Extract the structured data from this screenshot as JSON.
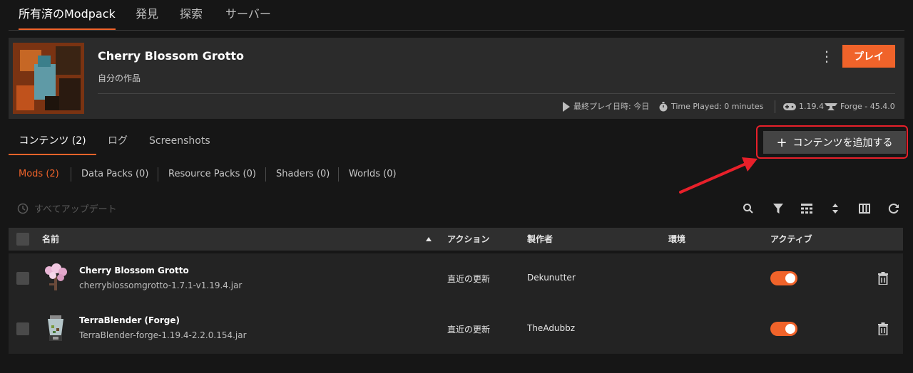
{
  "top_tabs": [
    {
      "label": "所有済のModpack",
      "active": true
    },
    {
      "label": "発見",
      "active": false
    },
    {
      "label": "探索",
      "active": false
    },
    {
      "label": "サーバー",
      "active": false
    }
  ],
  "modpack": {
    "title": "Cherry Blossom Grotto",
    "subtitle": "自分の作品",
    "play_label": "プレイ",
    "last_played": "最終プレイ日時: 今日",
    "time_played": "Time Played: 0 minutes",
    "mc_version": "1.19.4",
    "loader": "Forge - 45.4.0"
  },
  "content_tabs": [
    {
      "label": "コンテンツ (2)",
      "active": true
    },
    {
      "label": "ログ",
      "active": false
    },
    {
      "label": "Screenshots",
      "active": false
    }
  ],
  "add_content_label": "コンテンツを追加する",
  "sub_tabs": [
    {
      "label": "Mods (2)",
      "active": true
    },
    {
      "label": "Data Packs (0)",
      "active": false
    },
    {
      "label": "Resource Packs (0)",
      "active": false
    },
    {
      "label": "Shaders (0)",
      "active": false
    },
    {
      "label": "Worlds (0)",
      "active": false
    }
  ],
  "update_all_label": "すべてアップデート",
  "table": {
    "columns": [
      "名前",
      "アクション",
      "製作者",
      "環境",
      "アクティブ"
    ],
    "rows": [
      {
        "name": "Cherry Blossom Grotto",
        "file": "cherryblossomgrotto-1.7.1-v1.19.4.jar",
        "action": "直近の更新",
        "author": "Dekunutter",
        "env": "",
        "active": true
      },
      {
        "name": "TerraBlender (Forge)",
        "file": "TerraBlender-forge-1.19.4-2.2.0.154.jar",
        "action": "直近の更新",
        "author": "TheAdubbz",
        "env": "",
        "active": true
      }
    ]
  },
  "colors": {
    "accent": "#f0632a",
    "highlight": "#e8202a",
    "background": "#161616"
  }
}
